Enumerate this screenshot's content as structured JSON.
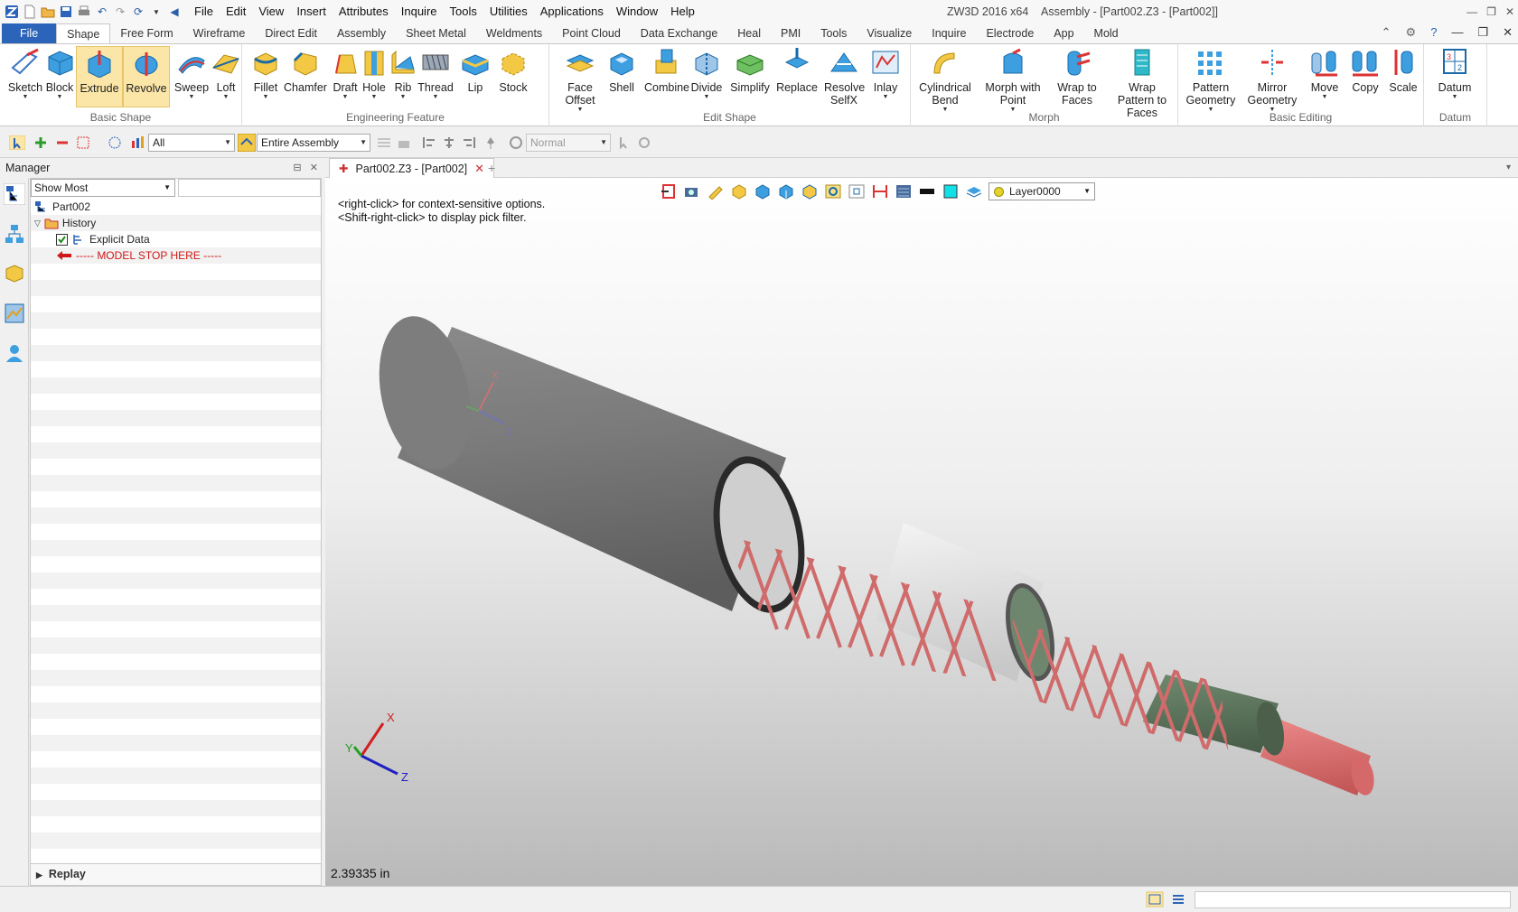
{
  "titlebar": {
    "menu": [
      "File",
      "Edit",
      "View",
      "Insert",
      "Attributes",
      "Inquire",
      "Tools",
      "Utilities",
      "Applications",
      "Window",
      "Help"
    ],
    "app_title": "ZW3D 2016  x64",
    "doc_title": "Assembly - [Part002.Z3 - [Part002]]"
  },
  "ribbon_tabs": [
    "File",
    "Shape",
    "Free Form",
    "Wireframe",
    "Direct Edit",
    "Assembly",
    "Sheet Metal",
    "Weldments",
    "Point Cloud",
    "Data Exchange",
    "Heal",
    "PMI",
    "Tools",
    "Visualize",
    "Inquire",
    "Electrode",
    "App",
    "Mold"
  ],
  "active_tab": "Shape",
  "ribbon": {
    "groups": [
      {
        "label": "Basic Shape",
        "buttons": [
          {
            "label": "Sketch"
          },
          {
            "label": "Block"
          },
          {
            "label": "Extrude"
          },
          {
            "label": "Revolve"
          },
          {
            "label": "Sweep"
          },
          {
            "label": "Loft"
          }
        ]
      },
      {
        "label": "Engineering Feature",
        "buttons": [
          {
            "label": "Fillet"
          },
          {
            "label": "Chamfer"
          },
          {
            "label": "Draft"
          },
          {
            "label": "Hole"
          },
          {
            "label": "Rib"
          },
          {
            "label": "Thread"
          },
          {
            "label": "Lip"
          },
          {
            "label": "Stock"
          }
        ]
      },
      {
        "label": "Edit Shape",
        "buttons": [
          {
            "label": "Face Offset"
          },
          {
            "label": "Shell"
          },
          {
            "label": "Combine"
          },
          {
            "label": "Divide"
          },
          {
            "label": "Simplify"
          },
          {
            "label": "Replace"
          },
          {
            "label": "Resolve SelfX"
          },
          {
            "label": "Inlay"
          }
        ]
      },
      {
        "label": "Morph",
        "buttons": [
          {
            "label": "Cylindrical Bend"
          },
          {
            "label": "Morph with Point"
          },
          {
            "label": "Wrap to Faces"
          },
          {
            "label": "Wrap Pattern to Faces"
          }
        ]
      },
      {
        "label": "Basic Editing",
        "buttons": [
          {
            "label": "Pattern Geometry"
          },
          {
            "label": "Mirror Geometry"
          },
          {
            "label": "Move"
          },
          {
            "label": "Copy"
          },
          {
            "label": "Scale"
          }
        ]
      },
      {
        "label": "Datum",
        "buttons": [
          {
            "label": "Datum"
          }
        ]
      }
    ]
  },
  "cmdbar": {
    "filter_value": "All",
    "scope_value": "Entire Assembly",
    "mode_value": "Normal"
  },
  "manager": {
    "title": "Manager",
    "filter_value": "Show Most",
    "tree": [
      {
        "label": "Part002"
      },
      {
        "label": "History"
      },
      {
        "label": "Explicit Data"
      },
      {
        "label": "----- MODEL STOP HERE -----"
      }
    ],
    "replay_label": "Replay"
  },
  "document": {
    "tab_label": "Part002.Z3 - [Part002]"
  },
  "viewport": {
    "hint_line1": "<right-click> for context-sensitive options.",
    "hint_line2": "<Shift-right-click> to display pick filter.",
    "layer": "Layer0000",
    "measure": "2.39335 in",
    "axis_x": "X",
    "axis_y": "Y",
    "axis_z": "Z"
  },
  "colors": {
    "accent": "#2b64b8",
    "outer_jacket": "#7a7a7a",
    "braid": "#cf6b6b",
    "dielectric": "#e8e8e8",
    "inner_jacket": "#5f7a5f",
    "core": "#e07070"
  },
  "icons": [
    "sketch-icon",
    "block-icon",
    "extrude-icon",
    "revolve-icon",
    "sweep-icon",
    "loft-icon",
    "fillet-icon",
    "chamfer-icon",
    "draft-icon",
    "hole-icon",
    "rib-icon",
    "thread-icon",
    "lip-icon",
    "stock-icon",
    "face-offset-icon",
    "shell-icon",
    "combine-icon",
    "divide-icon",
    "simplify-icon",
    "replace-icon",
    "resolve-selfx-icon",
    "inlay-icon",
    "cylindrical-bend-icon",
    "morph-with-point-icon",
    "wrap-to-faces-icon",
    "wrap-pattern-icon",
    "pattern-geometry-icon",
    "mirror-geometry-icon",
    "move-icon",
    "copy-icon",
    "scale-icon",
    "datum-icon"
  ]
}
